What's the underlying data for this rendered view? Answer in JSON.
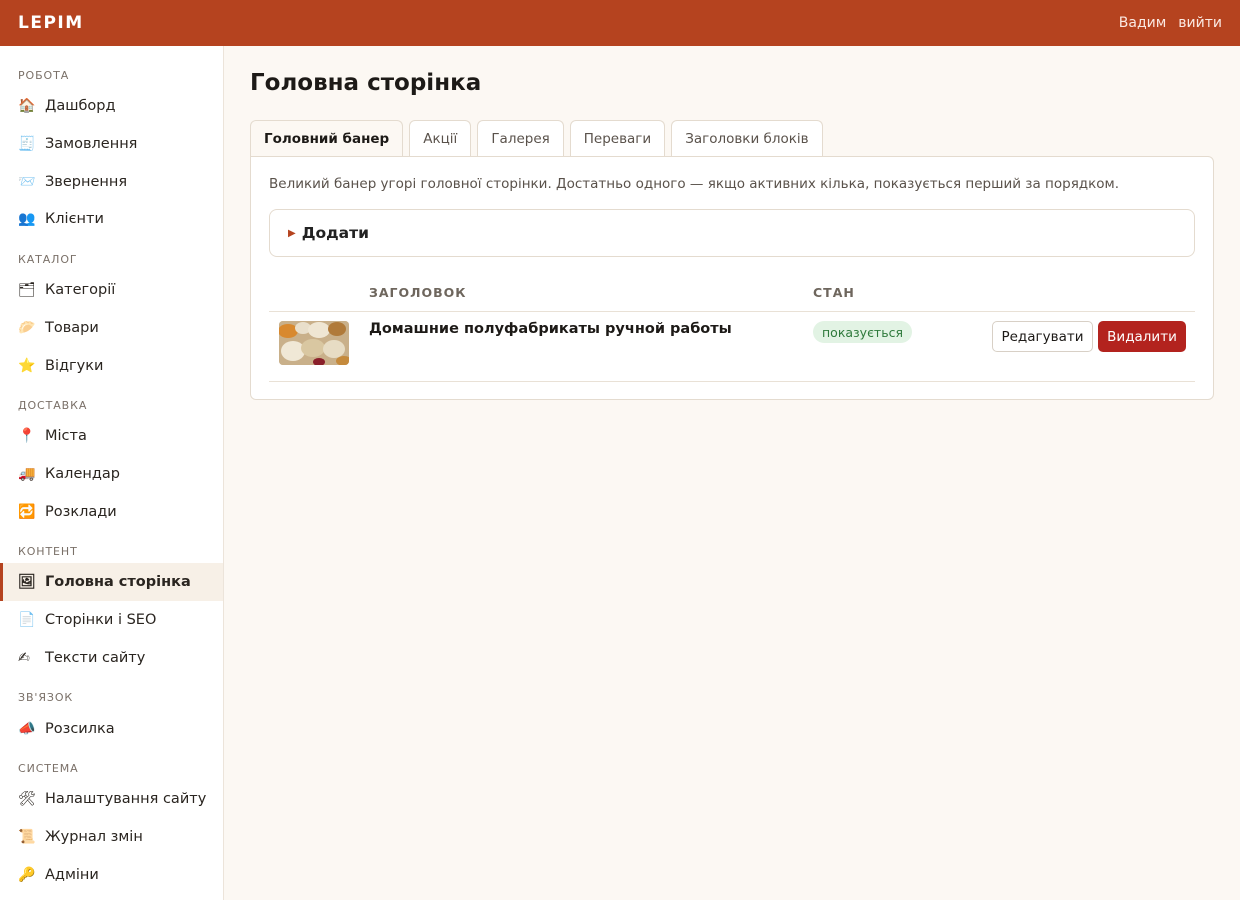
{
  "header": {
    "logo": "LEPIM",
    "user": "Вадим",
    "logout": "вийти"
  },
  "sidebar": {
    "groups": [
      {
        "title": "РОБОТА",
        "items": [
          {
            "icon": "🏠",
            "label": "Дашборд"
          },
          {
            "icon": "🧾",
            "label": "Замовлення"
          },
          {
            "icon": "📨",
            "label": "Звернення"
          },
          {
            "icon": "👥",
            "label": "Клієнти"
          }
        ]
      },
      {
        "title": "КАТАЛОГ",
        "items": [
          {
            "icon": "🗂",
            "label": "Категорії"
          },
          {
            "icon": "🥟",
            "label": "Товари"
          },
          {
            "icon": "⭐",
            "label": "Відгуки"
          }
        ]
      },
      {
        "title": "ДОСТАВКА",
        "items": [
          {
            "icon": "📍",
            "label": "Міста"
          },
          {
            "icon": "🚚",
            "label": "Календар"
          },
          {
            "icon": "🔁",
            "label": "Розклади"
          }
        ]
      },
      {
        "title": "КОНТЕНТ",
        "items": [
          {
            "icon": "🖼",
            "label": "Головна сторінка",
            "active": true
          },
          {
            "icon": "📄",
            "label": "Сторінки і SEO"
          },
          {
            "icon": "✍",
            "label": "Тексти сайту"
          }
        ]
      },
      {
        "title": "ЗВ'ЯЗОК",
        "items": [
          {
            "icon": "📣",
            "label": "Розсилка"
          }
        ]
      },
      {
        "title": "СИСТЕМА",
        "items": [
          {
            "icon": "🛠",
            "label": "Налаштування сайту"
          },
          {
            "icon": "📜",
            "label": "Журнал змін"
          },
          {
            "icon": "🔑",
            "label": "Адміни"
          }
        ]
      }
    ]
  },
  "main": {
    "title": "Головна сторінка",
    "tabs": [
      {
        "label": "Головний банер",
        "active": true
      },
      {
        "label": "Акції"
      },
      {
        "label": "Галерея"
      },
      {
        "label": "Переваги"
      },
      {
        "label": "Заголовки блоків"
      }
    ],
    "description": "Великий банер угорі головної сторінки. Достатньо одного — якщо активних кілька, показується перший за порядком.",
    "add_label": "Додати",
    "table": {
      "columns": {
        "title": "ЗАГОЛОВОК",
        "state": "СТАН"
      },
      "rows": [
        {
          "title": "Домашние полуфабрикаты ручной работы",
          "status": "показується",
          "edit": "Редагувати",
          "delete": "Видалити"
        }
      ]
    }
  },
  "colors": {
    "brand": "#b5431f",
    "danger": "#b3231e",
    "success_bg": "#e2f3e4",
    "success_text": "#2f7a3c"
  }
}
